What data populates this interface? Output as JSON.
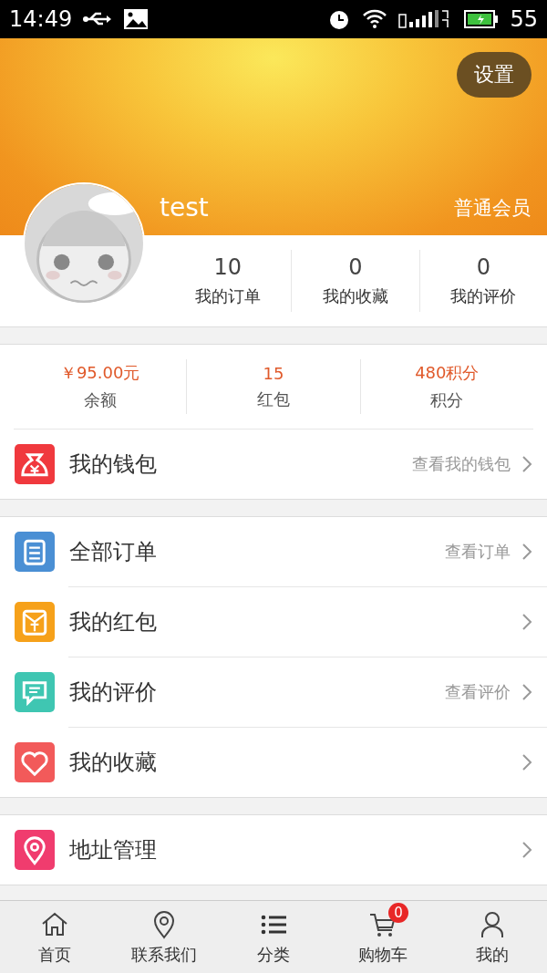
{
  "status_bar": {
    "time": "14:49",
    "battery": "55"
  },
  "header": {
    "settings_button": "设置",
    "username": "test",
    "member_level": "普通会员"
  },
  "stats": [
    {
      "value": "10",
      "label": "我的订单"
    },
    {
      "value": "0",
      "label": "我的收藏"
    },
    {
      "value": "0",
      "label": "我的评价"
    }
  ],
  "balances": [
    {
      "value": "￥95.00元",
      "label": "余额"
    },
    {
      "value": "15",
      "label": "红包"
    },
    {
      "value": "480积分",
      "label": "积分"
    }
  ],
  "menu_groups": [
    [
      {
        "label": "我的钱包",
        "hint": "查看我的钱包",
        "color": "#f0393e"
      }
    ],
    [
      {
        "label": "全部订单",
        "hint": "查看订单",
        "color": "#4a8fd4"
      },
      {
        "label": "我的红包",
        "color": "#f6a11a"
      },
      {
        "label": "我的评价",
        "hint": "查看评价",
        "color": "#3fc6b2"
      },
      {
        "label": "我的收藏",
        "color": "#f25a5a"
      }
    ],
    [
      {
        "label": "地址管理",
        "color": "#f03c6e"
      }
    ]
  ],
  "bottom_nav": [
    {
      "label": "首页"
    },
    {
      "label": "联系我们"
    },
    {
      "label": "分类"
    },
    {
      "label": "购物车",
      "badge": "0"
    },
    {
      "label": "我的"
    }
  ]
}
